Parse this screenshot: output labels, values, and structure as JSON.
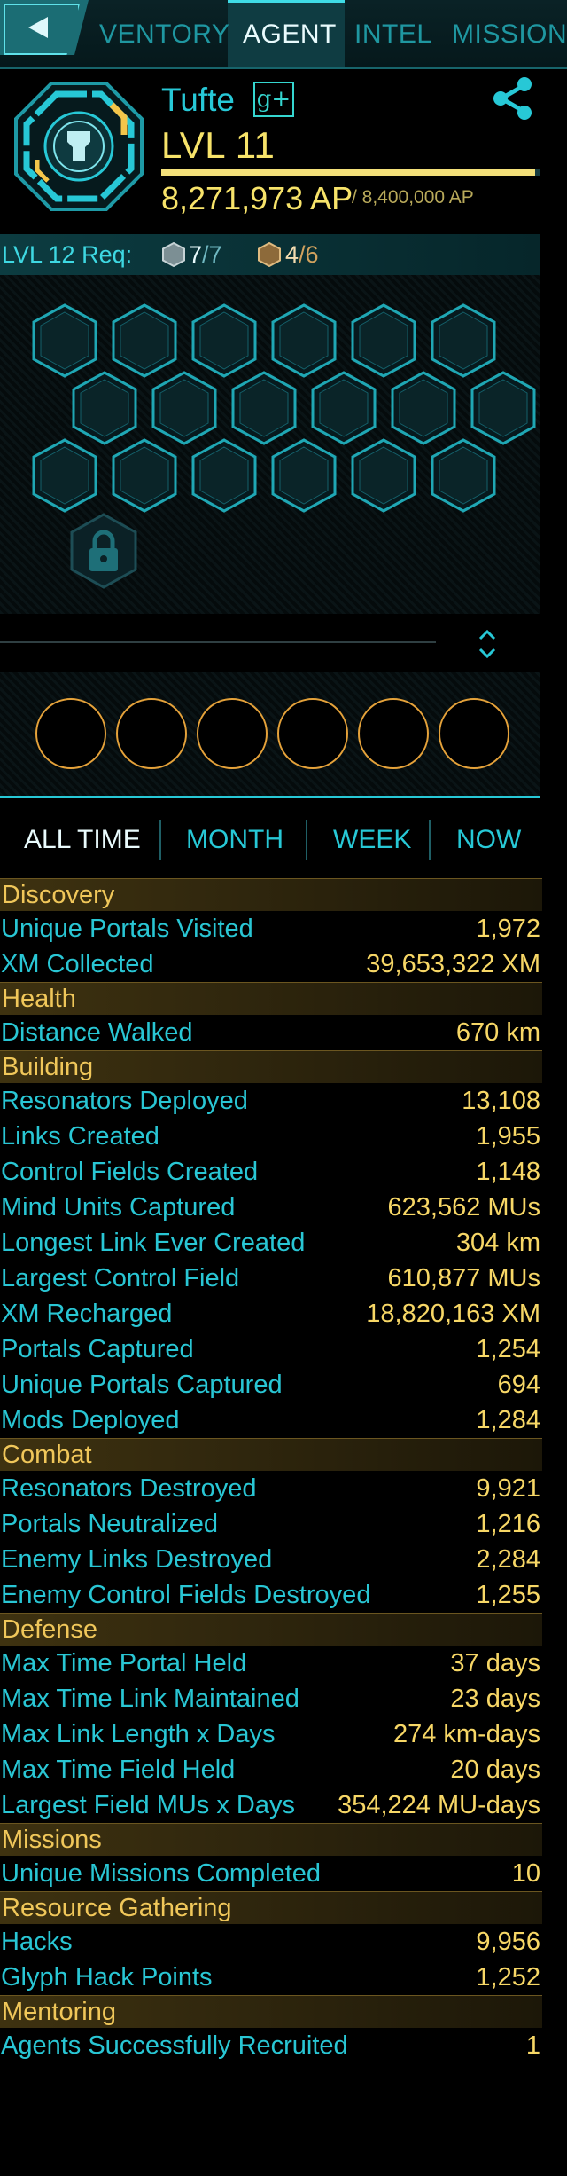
{
  "nav": {
    "back_icon": "back-arrow-icon",
    "tabs": [
      {
        "label": "VENTORY",
        "active": false
      },
      {
        "label": "AGENT",
        "active": true
      },
      {
        "label": "INTEL",
        "active": false
      },
      {
        "label": "MISSION",
        "active": false
      }
    ]
  },
  "agent": {
    "name": "Tufte",
    "gplus_label": "g+",
    "level": "LVL 11",
    "ap_current": "8,271,973 AP",
    "ap_max": "/ 8,400,000 AP",
    "ap_progress": 0.985,
    "faction_icon": "enlightened-badge-icon",
    "share_icon": "share-icon"
  },
  "requirements": {
    "label": "LVL 12 Req:",
    "silver": {
      "have": "7",
      "need": "/7"
    },
    "gold": {
      "have": "4",
      "need": "/6"
    }
  },
  "medals": {
    "hex_rows": [
      6,
      6,
      6
    ],
    "locked_icon": "lock-icon",
    "ring_count": 6,
    "expand_icon": "expand-collapse-icon"
  },
  "filters": [
    "ALL TIME",
    "MONTH",
    "WEEK",
    "NOW"
  ],
  "colors": {
    "cyan": "#27c8d6",
    "gold": "#f7d766",
    "section": "#f0c75a",
    "ring": "#e5a23a"
  },
  "sections": [
    {
      "title": "Discovery",
      "rows": [
        {
          "label": "Unique Portals Visited",
          "value": "1,972"
        },
        {
          "label": "XM Collected",
          "value": "39,653,322 XM"
        }
      ]
    },
    {
      "title": "Health",
      "rows": [
        {
          "label": "Distance Walked",
          "value": "670 km"
        }
      ]
    },
    {
      "title": "Building",
      "rows": [
        {
          "label": "Resonators Deployed",
          "value": "13,108"
        },
        {
          "label": "Links Created",
          "value": "1,955"
        },
        {
          "label": "Control Fields Created",
          "value": "1,148"
        },
        {
          "label": "Mind Units Captured",
          "value": "623,562 MUs"
        },
        {
          "label": "Longest Link Ever Created",
          "value": "304 km"
        },
        {
          "label": "Largest Control Field",
          "value": "610,877 MUs"
        },
        {
          "label": "XM Recharged",
          "value": "18,820,163 XM"
        },
        {
          "label": "Portals Captured",
          "value": "1,254"
        },
        {
          "label": "Unique Portals Captured",
          "value": "694"
        },
        {
          "label": "Mods Deployed",
          "value": "1,284"
        }
      ]
    },
    {
      "title": "Combat",
      "rows": [
        {
          "label": "Resonators Destroyed",
          "value": "9,921"
        },
        {
          "label": "Portals Neutralized",
          "value": "1,216"
        },
        {
          "label": "Enemy Links Destroyed",
          "value": "2,284"
        },
        {
          "label": "Enemy Control Fields Destroyed",
          "value": "1,255"
        }
      ]
    },
    {
      "title": "Defense",
      "rows": [
        {
          "label": "Max Time Portal Held",
          "value": "37 days"
        },
        {
          "label": "Max Time Link Maintained",
          "value": "23 days"
        },
        {
          "label": "Max Link Length x Days",
          "value": "274 km-days"
        },
        {
          "label": "Max Time Field Held",
          "value": "20 days"
        },
        {
          "label": "Largest Field MUs x Days",
          "value": "354,224 MU-days"
        }
      ]
    },
    {
      "title": "Missions",
      "rows": [
        {
          "label": "Unique Missions Completed",
          "value": "10"
        }
      ]
    },
    {
      "title": "Resource Gathering",
      "rows": [
        {
          "label": "Hacks",
          "value": "9,956"
        },
        {
          "label": "Glyph Hack Points",
          "value": "1,252"
        }
      ]
    },
    {
      "title": "Mentoring",
      "rows": [
        {
          "label": "Agents Successfully Recruited",
          "value": "1"
        }
      ]
    }
  ]
}
